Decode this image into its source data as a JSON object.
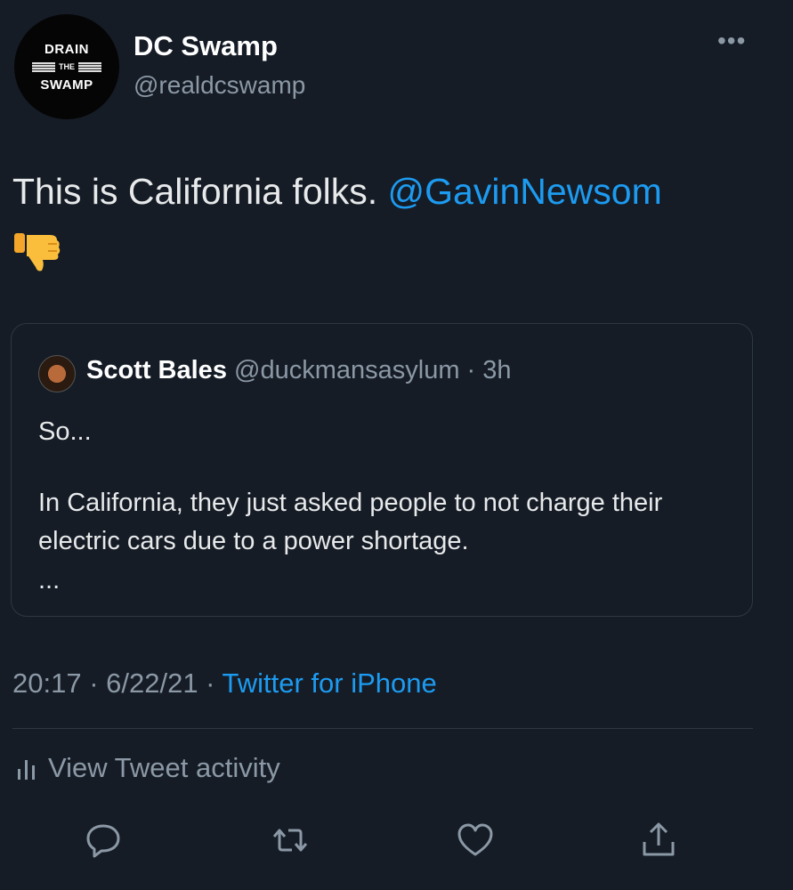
{
  "author": {
    "avatar": {
      "top": "DRAIN",
      "middle": "THE",
      "bottom": "SWAMP"
    },
    "display_name": "DC Swamp",
    "handle": "@realdcswamp"
  },
  "more_icon": "more-horizontal-icon",
  "tweet": {
    "text": "This is California folks. ",
    "mention": "@GavinNewsom",
    "emoji": "thumbs-down-icon"
  },
  "quoted": {
    "name": "Scott Bales",
    "meta": " @duckmansasylum · 3h",
    "line1": "So...",
    "line2": "In California, they just asked people to not charge their electric cars due to a power shortage.",
    "ellipsis": "..."
  },
  "timestamp": {
    "time": "20:17 · 6/22/21 · ",
    "source": "Twitter for iPhone"
  },
  "activity": {
    "label": "View Tweet activity",
    "icon": "bar-chart-icon"
  },
  "actions": [
    "reply-icon",
    "retweet-icon",
    "like-icon",
    "share-icon"
  ],
  "colors": {
    "background": "#151c26",
    "accent": "#1d9bf0",
    "muted": "#8b98a5"
  }
}
